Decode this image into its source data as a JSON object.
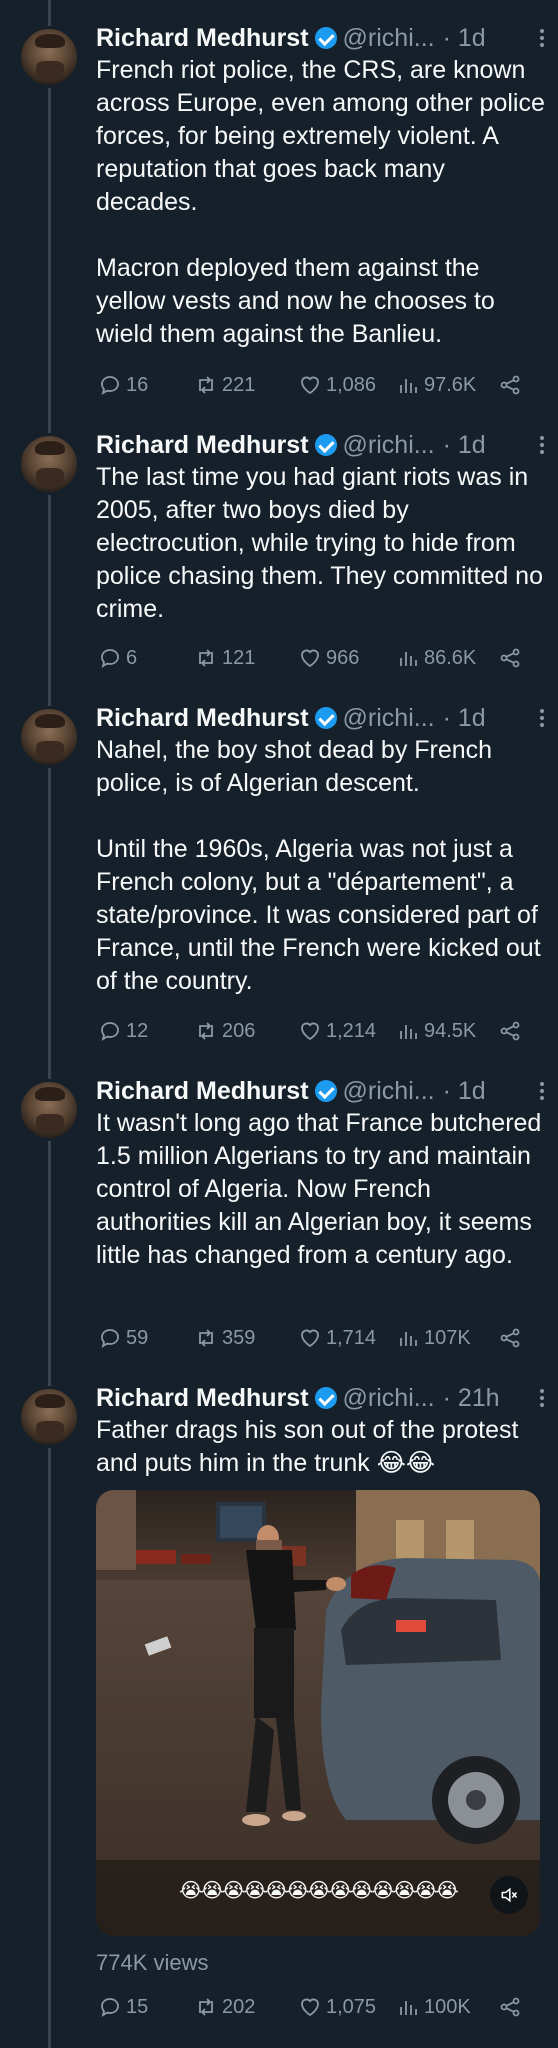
{
  "author": {
    "name": "Richard Medhurst",
    "handle": "@richi...",
    "verified": true
  },
  "colors": {
    "background": "#15202b",
    "text": "#f7f9f9",
    "secondary": "#8b98a5",
    "verified_badge": "#1d9bf0"
  },
  "tweets": [
    {
      "time": "· 1d",
      "text": "French riot police, the CRS, are known across Europe, even among other police forces, for being extremely violent. A reputation that goes back many decades.\n\nMacron deployed them against the yellow vests and now he chooses to wield them against the Banlieu.",
      "replies": "16",
      "retweets": "221",
      "likes": "1,086",
      "views": "97.6K"
    },
    {
      "time": "· 1d",
      "text": "The last time you had giant riots was in 2005, after two boys died by electrocution, while trying to hide from police chasing them. They committed no crime.",
      "replies": "6",
      "retweets": "121",
      "likes": "966",
      "views": "86.6K"
    },
    {
      "time": "· 1d",
      "text": "Nahel, the boy shot dead by French police, is of Algerian descent.\n\nUntil the 1960s, Algeria was not just a French colony, but a \"département\", a state/province. It was considered part of France, until the French were kicked out of the country.",
      "replies": "12",
      "retweets": "206",
      "likes": "1,214",
      "views": "94.5K"
    },
    {
      "time": "· 1d",
      "text": "It wasn't long ago that France butchered 1.5 million Algerians to try and maintain control of Algeria. Now French authorities kill an Algerian boy, it seems little has changed from a century ago.",
      "replies": "59",
      "retweets": "359",
      "likes": "1,714",
      "views": "107K"
    },
    {
      "time": "· 21h",
      "text": "Father drags his son out of the protest and puts him in the trunk 😂😂",
      "media_caption": "😭😭😭😭😭😭😭😭😭😭😭😭😭",
      "media_views": "774K views",
      "replies": "15",
      "retweets": "202",
      "likes": "1,075",
      "views": "100K"
    }
  ],
  "icons": [
    "reply-icon",
    "retweet-icon",
    "like-icon",
    "views-icon",
    "share-icon",
    "more-icon",
    "mute-icon",
    "verified-badge-icon"
  ]
}
